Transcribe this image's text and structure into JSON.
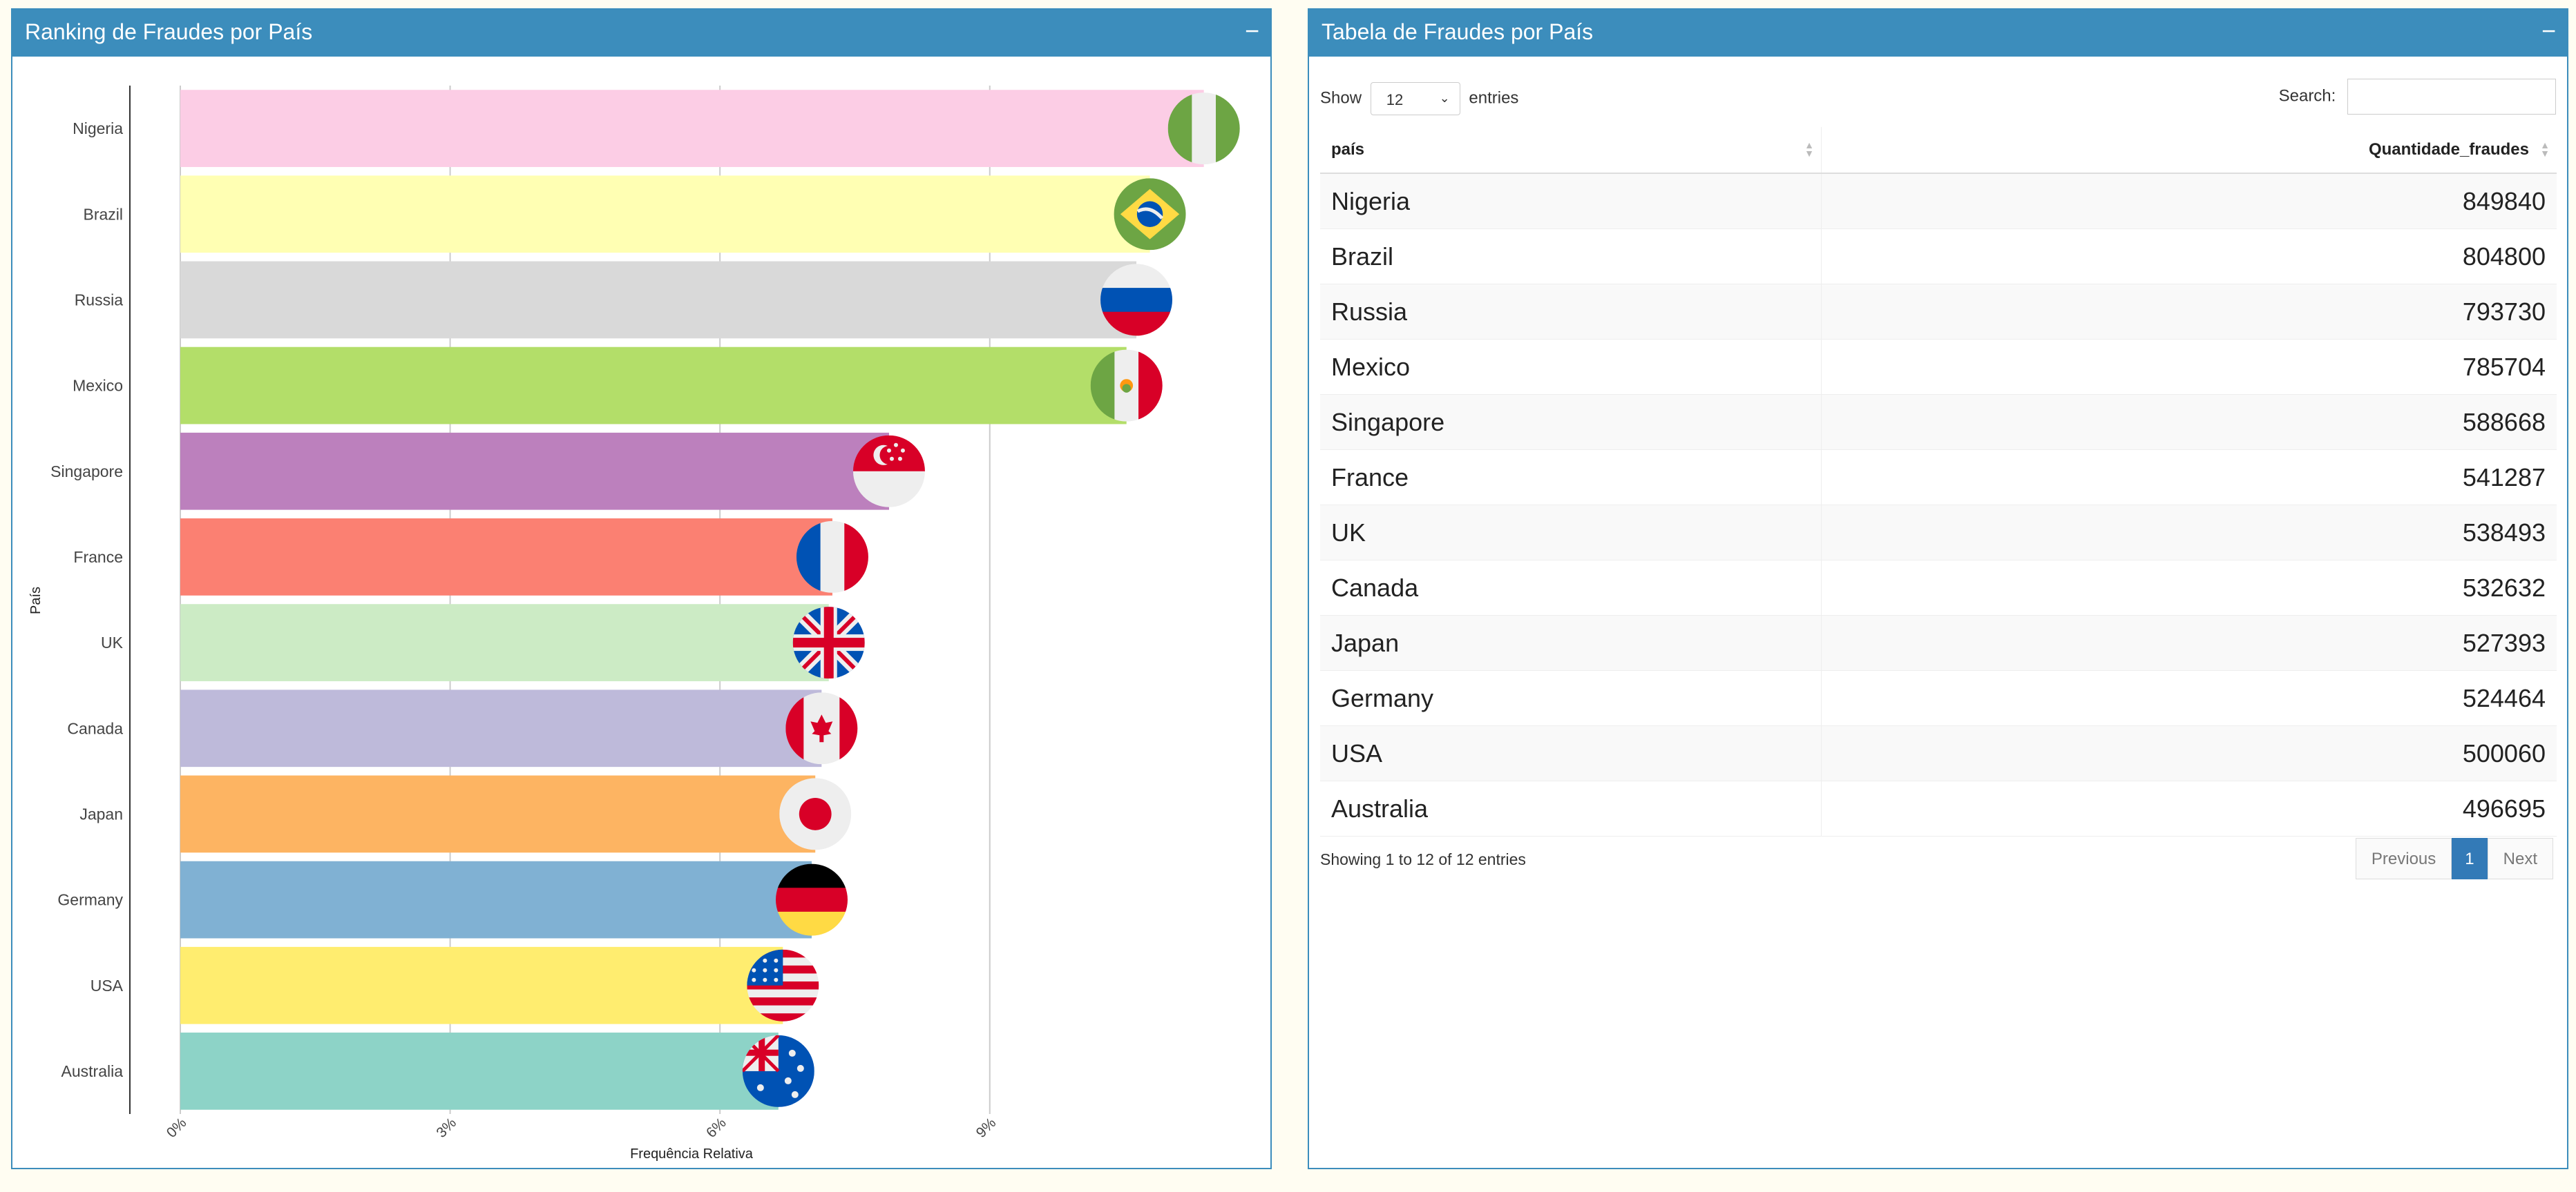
{
  "left_panel": {
    "title": "Ranking de Fraudes por País",
    "collapse": "−"
  },
  "right_panel": {
    "title": "Tabela de Fraudes por País",
    "collapse": "−"
  },
  "chart_data": {
    "type": "bar",
    "orientation": "horizontal",
    "xlabel": "Frequência Relativa",
    "ylabel": "País",
    "xlim": [
      0,
      12.5
    ],
    "xticks": [
      "0%",
      "3%",
      "6%",
      "9%"
    ],
    "xtick_values": [
      0,
      3,
      6,
      9
    ],
    "grid": true,
    "categories": [
      "Nigeria",
      "Brazil",
      "Russia",
      "Mexico",
      "Singapore",
      "France",
      "UK",
      "Canada",
      "Japan",
      "Germany",
      "USA",
      "Australia"
    ],
    "values": [
      11.38,
      10.78,
      10.63,
      10.52,
      7.88,
      7.25,
      7.21,
      7.13,
      7.06,
      7.02,
      6.7,
      6.65
    ],
    "colors": [
      "#fccde5",
      "#ffffb3",
      "#d9d9d9",
      "#b3de69",
      "#bc80bd",
      "#fb8072",
      "#ccebc5",
      "#bebada",
      "#fdb462",
      "#80b1d3",
      "#ffed6f",
      "#8dd3c7"
    ],
    "flag_icons": [
      "nigeria-flag-icon",
      "brazil-flag-icon",
      "russia-flag-icon",
      "mexico-flag-icon",
      "singapore-flag-icon",
      "france-flag-icon",
      "uk-flag-icon",
      "canada-flag-icon",
      "japan-flag-icon",
      "germany-flag-icon",
      "usa-flag-icon",
      "australia-flag-icon"
    ]
  },
  "table": {
    "show_label": "Show",
    "entries_label": "entries",
    "page_length": "12",
    "search_label": "Search:",
    "columns": [
      "país",
      "Quantidade_fraudes"
    ],
    "rows": [
      [
        "Nigeria",
        "849840"
      ],
      [
        "Brazil",
        "804800"
      ],
      [
        "Russia",
        "793730"
      ],
      [
        "Mexico",
        "785704"
      ],
      [
        "Singapore",
        "588668"
      ],
      [
        "France",
        "541287"
      ],
      [
        "UK",
        "538493"
      ],
      [
        "Canada",
        "532632"
      ],
      [
        "Japan",
        "527393"
      ],
      [
        "Germany",
        "524464"
      ],
      [
        "USA",
        "500060"
      ],
      [
        "Australia",
        "496695"
      ]
    ],
    "info": "Showing 1 to 12 of 12 entries",
    "pager": {
      "previous": "Previous",
      "current": "1",
      "next": "Next"
    }
  }
}
